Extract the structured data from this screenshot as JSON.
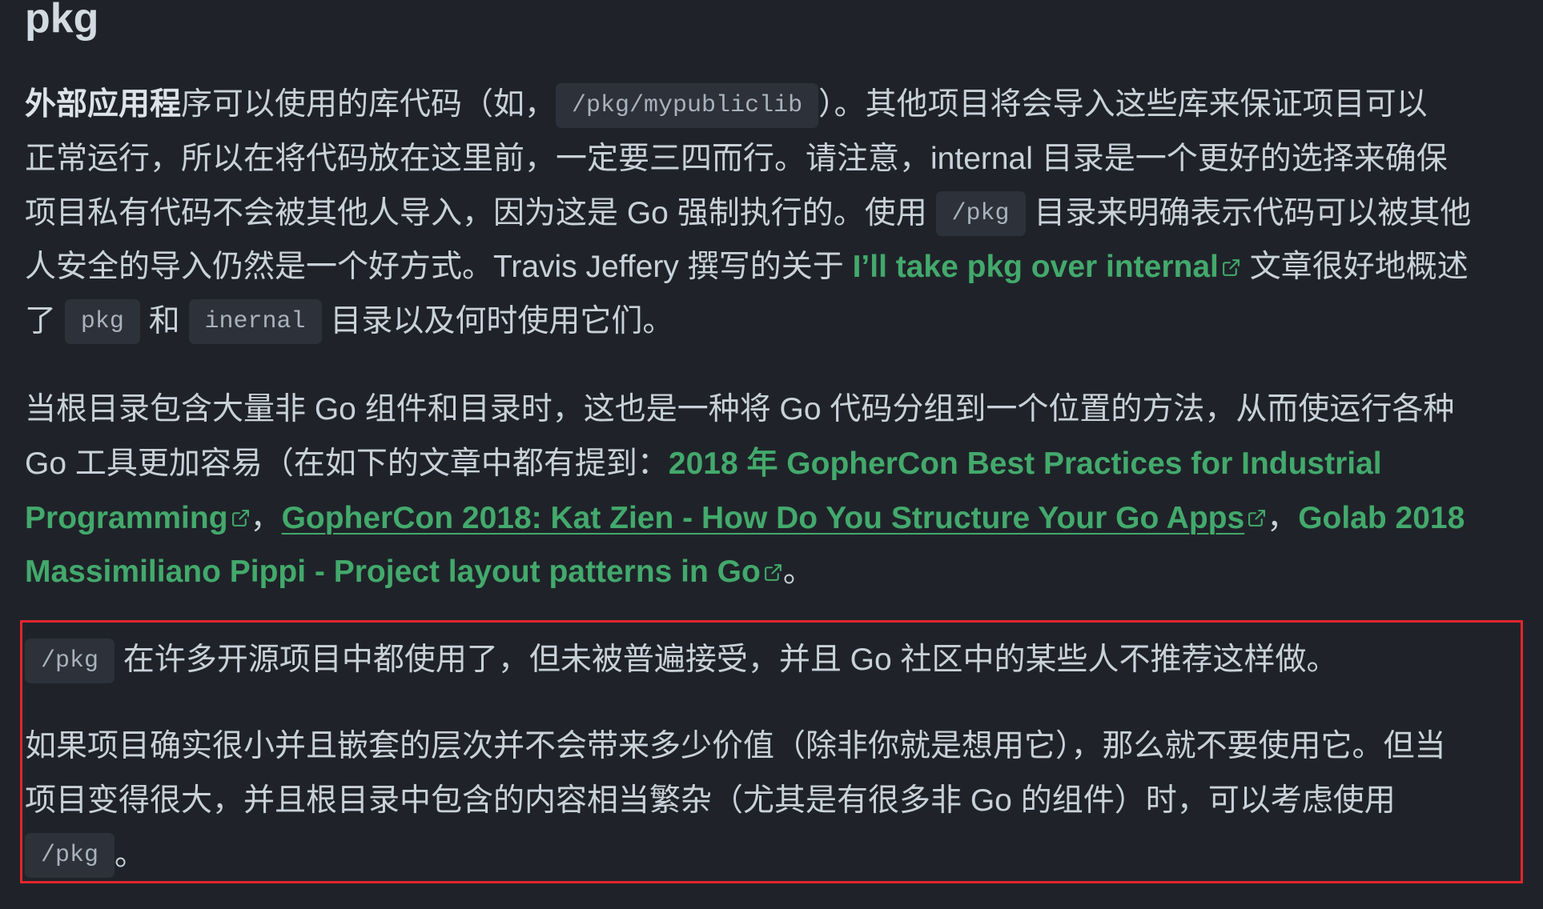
{
  "colors": {
    "background": "#1f2329",
    "text": "#c9d1d9",
    "heading": "#d3dae1",
    "link": "#43a96c",
    "code_background": "#2c313a",
    "code_text": "#a9b2bc",
    "highlight_border": "#e3252d"
  },
  "icons": {
    "external_link": "external-link-icon"
  },
  "section": {
    "heading": "pkg"
  },
  "intro": {
    "line1": {
      "bold": "外部应用程",
      "text_a": "序可以使用的库代码（如，",
      "code": "/pkg/mypubliclib",
      "text_b": "）。其他项目将会导入这些库来保证项目可以"
    },
    "line2": {
      "text": "正常运行，所以在将代码放在这里前，一定要三四而行。请注意，internal 目录是一个更好的选择来确保"
    },
    "line3": {
      "text_a": "项目私有代码不会被其他人导入，因为这是 Go 强制执行的。使用 ",
      "code": "/pkg",
      "text_b": " 目录来明确表示代码可以被其他"
    },
    "line4": {
      "text_a": "人安全的导入仍然是一个好方式。Travis Jeffery 撰写的关于 ",
      "link": "I’ll take pkg over internal",
      "text_b": " 文章很好地概述"
    },
    "line5": {
      "text_a": "了 ",
      "code_a": "pkg",
      "text_b": " 和 ",
      "code_b": "inernal",
      "text_c": " 目录以及何时使用它们。"
    }
  },
  "grouping": {
    "line1": {
      "text": "当根目录包含大量非 Go 组件和目录时，这也是一种将 Go 代码分组到一个位置的方法，从而使运行各种"
    },
    "line2": {
      "text": "Go 工具更加容易（在如下的文章中都有提到：",
      "link_a": "2018 年 GopherCon Best Practices for Industrial"
    },
    "line3": {
      "link_a": "Programming",
      "sep_a": "，",
      "link_b": "GopherCon 2018: Kat Zien - How Do You Structure Your Go Apps",
      "sep_b": "，",
      "link_c": "Golab 2018"
    },
    "line4": {
      "link_c": "Massimiliano Pippi - Project layout patterns in Go",
      "end": "。"
    }
  },
  "note": {
    "line1": {
      "code": "/pkg",
      "text": " 在许多开源项目中都使用了，但未被普遍接受，并且 Go 社区中的某些人不推荐这样做。"
    }
  },
  "advice": {
    "line1": {
      "text": "如果项目确实很小并且嵌套的层次并不会带来多少价值（除非你就是想用它），那么就不要使用它。但当"
    },
    "line2": {
      "text": "项目变得很大，并且根目录中包含的内容相当繁杂（尤其是有很多非 Go 的组件）时，可以考虑使用"
    },
    "line3": {
      "code": "/pkg",
      "text": "。"
    }
  }
}
